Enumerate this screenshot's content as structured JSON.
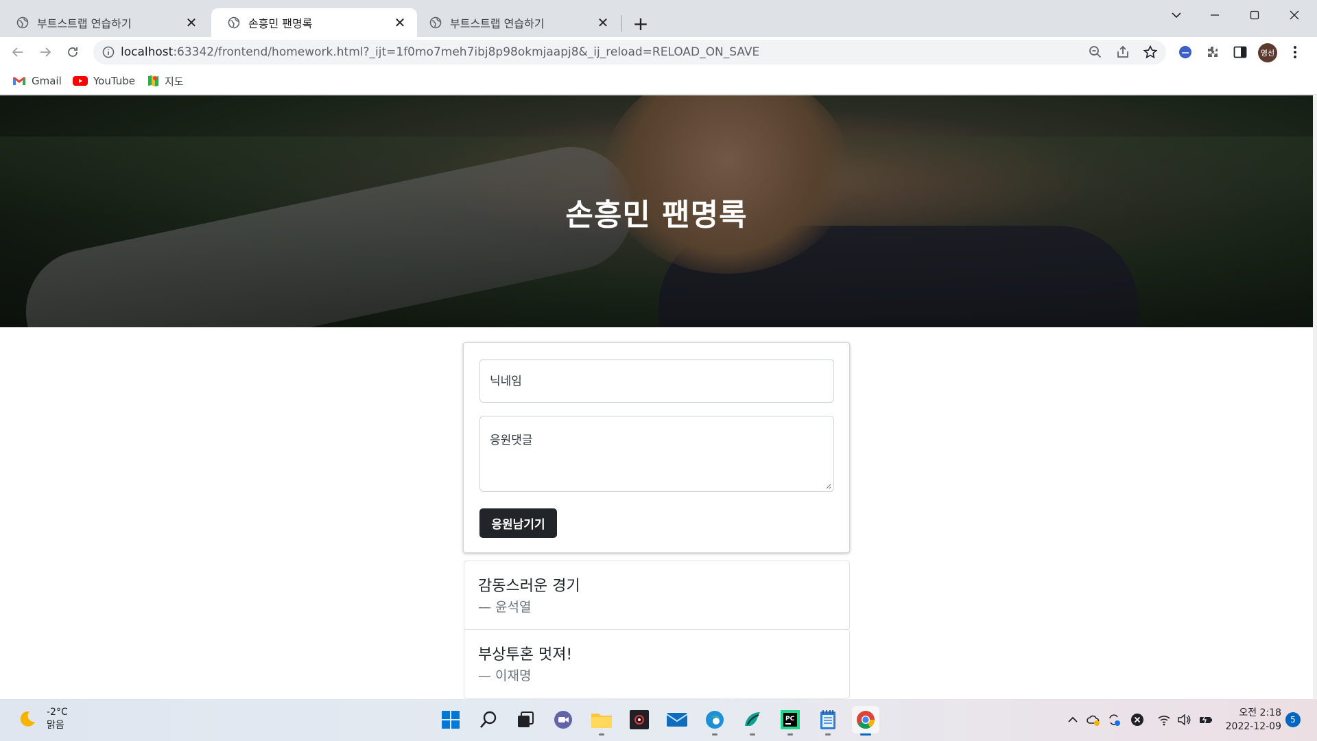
{
  "browser": {
    "tabs": [
      {
        "label": "부트스트랩 연습하기",
        "active": false
      },
      {
        "label": "손흥민 팬명록",
        "active": true
      },
      {
        "label": "부트스트랩 연습하기",
        "active": false
      }
    ],
    "close_glyph": "✕",
    "new_tab_glyph": "+",
    "url_host": "localhost",
    "url_rest": ":63342/frontend/homework.html?_ijt=1f0mo7meh7ibj8p98okmjaapj8&_ij_reload=RELOAD_ON_SAVE",
    "profile_initials": "영선",
    "bookmarks": [
      {
        "label": "Gmail",
        "icon": "gmail-icon"
      },
      {
        "label": "YouTube",
        "icon": "youtube-icon"
      },
      {
        "label": "지도",
        "icon": "maps-icon"
      }
    ]
  },
  "page": {
    "hero_title": "손흥민 팬명록",
    "form": {
      "nickname_placeholder": "닉네임",
      "comment_placeholder": "응원댓글",
      "submit_label": "응원남기기"
    },
    "comments": [
      {
        "text": "감동스러운 경기",
        "author": "— 윤석열"
      },
      {
        "text": "부상투혼 멋져!",
        "author": "— 이재명"
      }
    ]
  },
  "taskbar": {
    "weather_temp": "-2°C",
    "weather_desc": "맑음",
    "time": "오전 2:18",
    "date": "2022-12-09",
    "notification_count": "5"
  },
  "colors": {
    "button_dark": "#212529",
    "tabstrip": "#dee1e6",
    "accent_blue": "#0067c0"
  }
}
